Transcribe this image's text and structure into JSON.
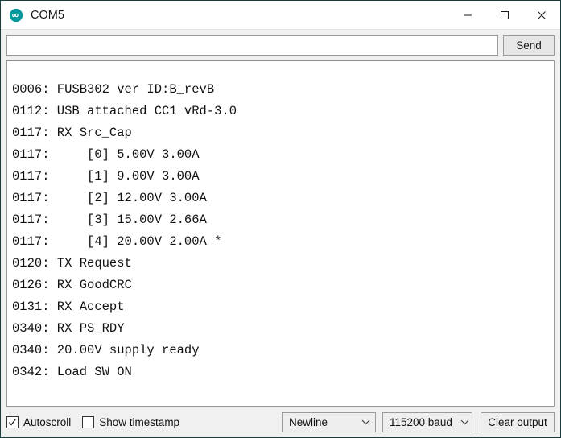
{
  "window": {
    "title": "COM5",
    "app_icon": "arduino-icon",
    "controls": {
      "minimize": "minimize-icon",
      "maximize": "maximize-icon",
      "close": "close-icon"
    },
    "accent_color": "#00979d",
    "border_color": "#1b3a3a"
  },
  "send_row": {
    "input_value": "",
    "input_placeholder": "",
    "send_label": "Send"
  },
  "console": {
    "lines": [
      "0006: FUSB302 ver ID:B_revB",
      "0112: USB attached CC1 vRd-3.0",
      "0117: RX Src_Cap",
      "0117:     [0] 5.00V 3.00A",
      "0117:     [1] 9.00V 3.00A",
      "0117:     [2] 12.00V 3.00A",
      "0117:     [3] 15.00V 2.66A",
      "0117:     [4] 20.00V 2.00A *",
      "0120: TX Request",
      "0126: RX GoodCRC",
      "0131: RX Accept",
      "0340: RX PS_RDY",
      "0340: 20.00V supply ready",
      "0342: Load SW ON"
    ]
  },
  "bottom_bar": {
    "autoscroll": {
      "label": "Autoscroll",
      "checked": true
    },
    "show_timestamp": {
      "label": "Show timestamp",
      "checked": false
    },
    "line_ending": {
      "selected": "Newline"
    },
    "baud_rate": {
      "selected": "115200 baud"
    },
    "clear_output_label": "Clear output"
  }
}
